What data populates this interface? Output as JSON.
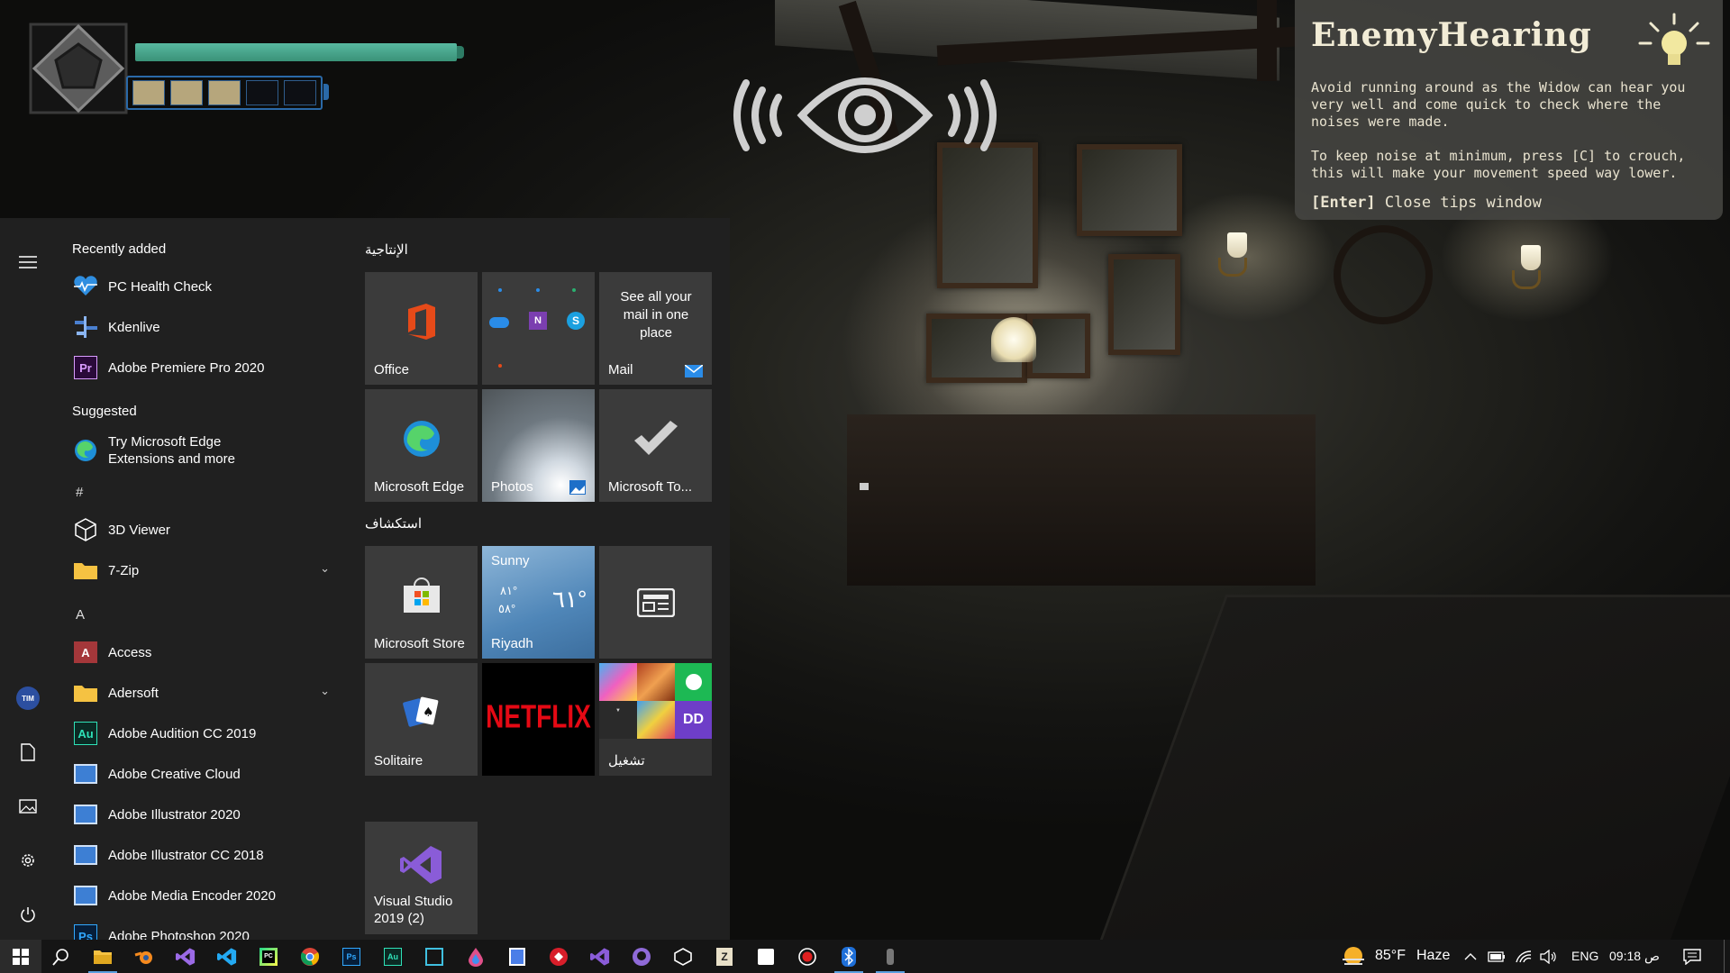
{
  "hud": {
    "health_level": 0.96,
    "stamina_filled": 3,
    "stamina_total": 5
  },
  "tips": {
    "title": "EnemyHearing",
    "paragraph1": "Avoid running around as the Widow can hear you very well and come quick to check where the noises were made.",
    "paragraph2": "To keep noise at minimum, press [C] to crouch, this will make your movement speed way lower.",
    "close_key": "[Enter]",
    "close_text": " Close tips window"
  },
  "start_menu": {
    "recently_added_label": "Recently added",
    "recent": [
      "PC Health Check",
      "Kdenlive",
      "Adobe Premiere Pro 2020"
    ],
    "suggested_label": "Suggested",
    "suggested_item": [
      "Try Microsoft Edge",
      "Extensions and more"
    ],
    "hash_header": "#",
    "apps_hash": [
      "3D Viewer",
      "7-Zip"
    ],
    "a_header": "A",
    "apps_a": [
      "Access",
      "Adersoft",
      "Adobe Audition CC 2019",
      "Adobe Creative Cloud",
      "Adobe Illustrator 2020",
      "Adobe Illustrator CC 2018",
      "Adobe Media Encoder 2020",
      "Adobe Photoshop 2020"
    ],
    "group1_label": "الإنتاجية",
    "group2_label": "استكشاف",
    "tiles": {
      "office": "Office",
      "mail_text": "See all your mail in one place",
      "mail": "Mail",
      "edge": "Microsoft Edge",
      "photos": "Photos",
      "todo": "Microsoft To...",
      "store": "Microsoft Store",
      "weather_cond": "Sunny",
      "weather_hi": "٨١°",
      "weather_lo": "٥٨°",
      "weather_temp": "٦١°",
      "weather_city": "Riyadh",
      "solitaire": "Solitaire",
      "netflix": "NETFLIX",
      "play": "تشغيل",
      "vs": "Visual Studio 2019 (2)"
    }
  },
  "taskbar": {
    "weather_temp": "85°F",
    "weather_text": "Haze",
    "language": "ENG",
    "time": "09:18 ص"
  },
  "colors": {
    "health": "#4aa88c",
    "stamina_on": "#b6a67c",
    "stamina_border": "#2a69a8",
    "accent": "#0078d7",
    "netflix": "#e50914"
  }
}
